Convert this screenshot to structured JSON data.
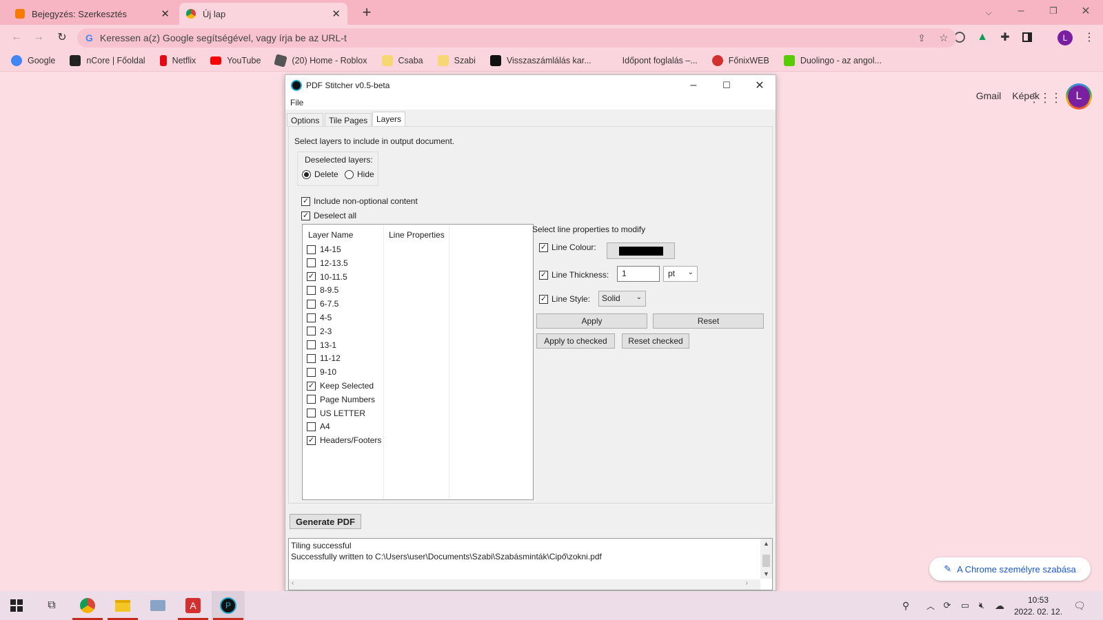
{
  "browser": {
    "tabs": [
      {
        "title": "Bejegyzés: Szerkesztés",
        "icon": "blogger-icon"
      },
      {
        "title": "Új lap",
        "icon": "chrome-icon"
      }
    ],
    "omnibox_placeholder": "Keressen a(z) Google segítségével, vagy írja be az URL-t",
    "profile_initial": "L",
    "bookmarks": [
      {
        "label": "Google",
        "color": "#4285f4"
      },
      {
        "label": "nCore | Főoldal",
        "color": "#222222"
      },
      {
        "label": "Netflix",
        "color": "#e50914"
      },
      {
        "label": "YouTube",
        "color": "#ff0000"
      },
      {
        "label": "(20) Home - Roblox",
        "color": "#555555"
      },
      {
        "label": "Csaba",
        "color": "#f7d774"
      },
      {
        "label": "Szabi",
        "color": "#f7d774"
      },
      {
        "label": "Visszaszámlálás kar...",
        "color": "#111111"
      },
      {
        "label": "Időpont foglalás –...",
        "color": "#00000000"
      },
      {
        "label": "FőnixWEB",
        "color": "#d32f2f"
      },
      {
        "label": "Duolingo - az angol...",
        "color": "#58cc02"
      }
    ]
  },
  "google": {
    "gmail": "Gmail",
    "images": "Képek",
    "avatar": "L",
    "customize": "A Chrome személyre szabása"
  },
  "app": {
    "title": "PDF Stitcher v0.5-beta",
    "menu_file": "File",
    "tabs": [
      "Options",
      "Tile Pages",
      "Layers"
    ],
    "instruction": "Select layers to include in output document.",
    "deselected_group": "Deselected layers:",
    "radio_delete": "Delete",
    "radio_hide": "Hide",
    "include_nonoptional": "Include non-optional content",
    "deselect_all": "Deselect all",
    "col_layer_name": "Layer Name",
    "col_line_props": "Line Properties",
    "layers": [
      {
        "name": "14-15",
        "checked": false
      },
      {
        "name": "12-13.5",
        "checked": false
      },
      {
        "name": "10-11.5",
        "checked": true
      },
      {
        "name": "8-9.5",
        "checked": false
      },
      {
        "name": "6-7.5",
        "checked": false
      },
      {
        "name": "4-5",
        "checked": false
      },
      {
        "name": "2-3",
        "checked": false
      },
      {
        "name": "13-1",
        "checked": false
      },
      {
        "name": "11-12",
        "checked": false
      },
      {
        "name": "9-10",
        "checked": false
      },
      {
        "name": "Keep Selected",
        "checked": true
      },
      {
        "name": "Page Numbers",
        "checked": false
      },
      {
        "name": "US LETTER",
        "checked": false
      },
      {
        "name": "A4",
        "checked": false
      },
      {
        "name": "Headers/Footers",
        "checked": true
      }
    ],
    "line_props_title": "Select line properties to modify",
    "line_colour_label": "Line Colour:",
    "line_colour_value": "#000000",
    "line_thickness_label": "Line Thickness:",
    "line_thickness_value": "1",
    "line_thickness_unit": "pt",
    "line_style_label": "Line Style:",
    "line_style_value": "Solid",
    "apply": "Apply",
    "reset": "Reset",
    "apply_checked": "Apply to checked",
    "reset_checked": "Reset checked",
    "generate": "Generate PDF",
    "log_line1": "Tiling successful",
    "log_line2": "Successfully written to C:\\Users\\user\\Documents\\Szabi\\Szabásminták\\Cipő\\zokni.pdf"
  },
  "taskbar": {
    "time": "10:53",
    "date": "2022. 02. 12."
  }
}
